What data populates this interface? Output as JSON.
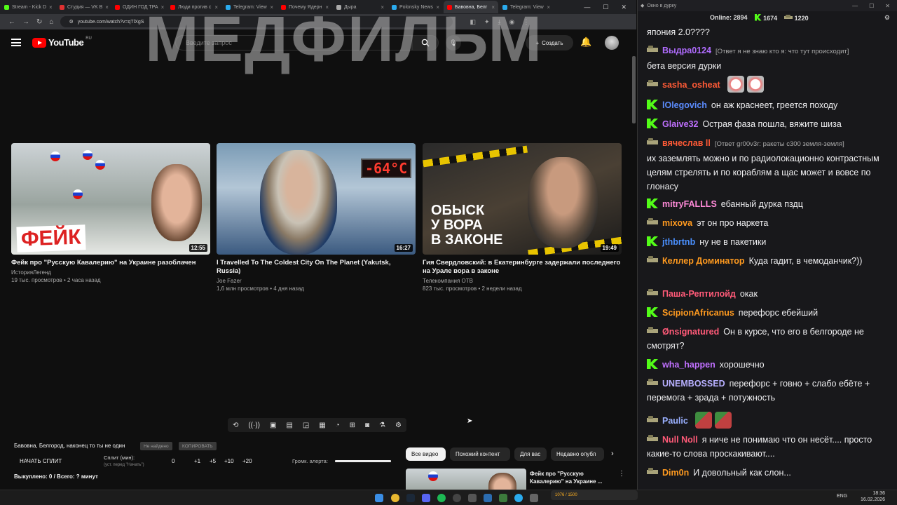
{
  "browser": {
    "tabs": [
      {
        "label": "Stream - Kick D",
        "color": "#53fc18",
        "active": false
      },
      {
        "label": "Студия — VK В",
        "color": "#e03131",
        "active": false
      },
      {
        "label": "ОДИН ГОД ТРА",
        "color": "#ff0000",
        "active": false
      },
      {
        "label": "Люди против с",
        "color": "#ff0000",
        "active": false
      },
      {
        "label": "Telegram: View",
        "color": "#2aabee",
        "active": false
      },
      {
        "label": "Почему Ядерн",
        "color": "#ff0000",
        "active": false
      },
      {
        "label": "Дыра",
        "color": "#aaaaaa",
        "active": false
      },
      {
        "label": "Polonsky News",
        "color": "#2aabee",
        "active": false
      },
      {
        "label": "Бавовна, Белг",
        "color": "#ff0000",
        "active": true
      },
      {
        "label": "Telegram: View",
        "color": "#2aabee",
        "active": false
      }
    ],
    "url": "youtube.com/watch?v=qTlXgS"
  },
  "youtube": {
    "logo_text": "YouTube",
    "region": "RU",
    "search_placeholder": "Введите запрос",
    "create_label": "Создать",
    "overlay_title": "МЕДФИЛЬМ"
  },
  "videos": [
    {
      "title": "Фейк про \"Русскую Кавалерию\" на Украине разоблачен",
      "channel": "ИсторияЛегенд",
      "meta": "19 тыс. просмотров • 2 часа назад",
      "duration": "12:55",
      "thumb_text": "ФЕЙК"
    },
    {
      "title": "I Travelled To The Coldest City On The Planet (Yakutsk, Russia)",
      "channel": "Joe Fazer",
      "meta": "1,6 млн просмотров • 4 дня назад",
      "duration": "16:27",
      "thumb_text": "-64°C"
    },
    {
      "title": "Гия Свердловский: в Екатеринбурге задержали последнего на Урале вора в законе",
      "channel": "Телекомпания ОТВ",
      "meta": "823 тыс. просмотров • 2 недели назад",
      "duration": "19:49",
      "thumb_text": "ОБЫСК\nУ ВОРА\nВ ЗАКОНЕ"
    }
  ],
  "split_panel": {
    "title": "Бавовна, Белгород, наконец то ты не один",
    "btn_not_found": "Не найдено",
    "btn_copy": "КОПИРОВАТЬ",
    "start_label": "НАЧАТЬ СПЛИТ",
    "split_min_label": "Сплит (мин):",
    "split_hint": "(уст. перед \"Начать\")",
    "split_value": "0",
    "steps": [
      "+1",
      "+5",
      "+10",
      "+20"
    ],
    "alert_label": "Громк. алерта:",
    "alert_volume": 1.0,
    "bought": "Выкуплено: 0 / Всего: ? минут"
  },
  "chips": [
    {
      "label": "Все видео",
      "selected": true
    },
    {
      "label": "Похожий контент",
      "selected": false
    },
    {
      "label": "Для вас",
      "selected": false
    },
    {
      "label": "Недавно опубл",
      "selected": false
    }
  ],
  "related": {
    "title": "Фейк про \"Русскую Кавалерию\" на Украине ..."
  },
  "chat": {
    "window_title": "Окно в дурку",
    "online_label": "Online:",
    "online": "2894",
    "kick_count": "1674",
    "tank_count": "1220",
    "messages": [
      {
        "badge": "",
        "nick": "",
        "color": "",
        "reply": "",
        "text": "япония 2.0????",
        "emotes": 0
      },
      {
        "badge": "tank",
        "nick": "Выдра0124",
        "color": "#b06cff",
        "reply": "[Ответ я не знаю кто я: что тут происходит]",
        "text": "бета версия дурки",
        "emotes": 0
      },
      {
        "badge": "tank",
        "nick": "sasha_osheat",
        "color": "#ff5a36",
        "reply": "",
        "text": "",
        "emotes": 2,
        "emote_kind": "pig"
      },
      {
        "badge": "kick",
        "nick": "lOlegovich",
        "color": "#5b8cff",
        "reply": "",
        "text": "он аж краснеет, греется походу",
        "emotes": 0
      },
      {
        "badge": "kick",
        "nick": "Glaive32",
        "color": "#c070ff",
        "reply": "",
        "text": "Острая фаза пошла, вяжите шиза",
        "emotes": 0
      },
      {
        "badge": "tank",
        "nick": "вячеслав ll",
        "color": "#ff5a36",
        "reply": "[Ответ gr00v3r: ракеты с300 земля-земля]",
        "text": "их заземлять можно и по радиолокационно контрастным целям стрелять и по кораблям а щас может и вовсе по глонасу",
        "emotes": 0
      },
      {
        "badge": "kick",
        "nick": "mitryFALLLS",
        "color": "#ff8ad8",
        "reply": "",
        "text": "ебанный дурка пздц",
        "emotes": 0
      },
      {
        "badge": "tank",
        "nick": "mixova",
        "color": "#ff9a1f",
        "reply": "",
        "text": "эт он про наркета",
        "emotes": 0
      },
      {
        "badge": "kick",
        "nick": "jthbrtnb",
        "color": "#4a90ff",
        "reply": "",
        "text": "ну не в пакетики",
        "emotes": 0
      },
      {
        "badge": "tank",
        "nick": "Келлер Доминатор",
        "color": "#ff9a1f",
        "reply": "",
        "text": "Куда гадит, в чемоданчик?))",
        "emotes": 0
      },
      {
        "badge": "tank",
        "nick": "Паша-Рептилойд",
        "color": "#ff5a78",
        "reply": "",
        "text": "окак",
        "emotes": 0
      },
      {
        "badge": "kick",
        "nick": "ScipionAfricanus",
        "color": "#ff9a1f",
        "reply": "",
        "text": "перефорс ебейший",
        "emotes": 0
      },
      {
        "badge": "tank",
        "nick": "Ønsignatured",
        "color": "#ff5a78",
        "reply": "",
        "text": "Он в курсе, что его в белгороде не смотрят?",
        "emotes": 0
      },
      {
        "badge": "kick",
        "nick": "wha_happen",
        "color": "#c070ff",
        "reply": "",
        "text": "хорошечно",
        "emotes": 0
      },
      {
        "badge": "tank",
        "nick": "UNEMBOSSED",
        "color": "#b8b0ff",
        "reply": "",
        "text": "перефорс + говно + слабо ебёте + перемога + зрада + потужность",
        "emotes": 0
      },
      {
        "badge": "tank",
        "nick": "Paulic",
        "color": "#9ab0ff",
        "reply": "",
        "text": "",
        "emotes": 2,
        "emote_kind": "melon"
      },
      {
        "badge": "tank",
        "nick": "Null Noll",
        "color": "#ff5a78",
        "reply": "",
        "text": "я ниче не понимаю что он несёт.... просто какие-то слова проскакивают....",
        "emotes": 0
      },
      {
        "badge": "tank",
        "nick": "Dim0n",
        "color": "#ff9a1f",
        "reply": "",
        "text": "И довольный как слон...",
        "emotes": 0
      }
    ]
  },
  "taskbar": {
    "game_text": "1076 / 1500",
    "lang": "ENG",
    "time": "18:36",
    "date": "16.02.2026"
  }
}
